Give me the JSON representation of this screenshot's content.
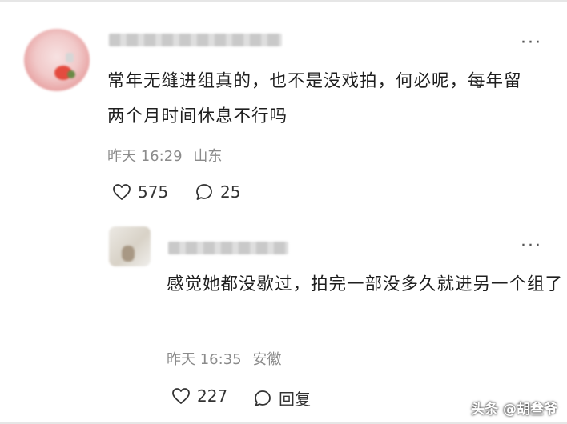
{
  "comment": {
    "avatar_icon": "user-avatar",
    "content": "常年无缝进组真的，也不是没戏拍，何必呢，每年留两个月时间休息不行吗",
    "time": "昨天 16:29",
    "location": "山东",
    "likes": "575",
    "replies": "25",
    "more_icon": "more-dots-icon"
  },
  "reply": {
    "avatar_icon": "user-avatar",
    "content": "感觉她都没歇过，拍完一部没多久就进另一个组了",
    "time": "昨天 16:35",
    "location": "安徽",
    "likes": "227",
    "reply_label": "回复",
    "more_icon": "more-dots-icon"
  },
  "watermark": "头条 @胡叁爷",
  "icons": {
    "like": "heart-icon",
    "comment": "comment-bubble-icon"
  },
  "colors": {
    "text": "#1f1f1f",
    "meta": "#8b8b8b",
    "background": "#ffffff"
  }
}
